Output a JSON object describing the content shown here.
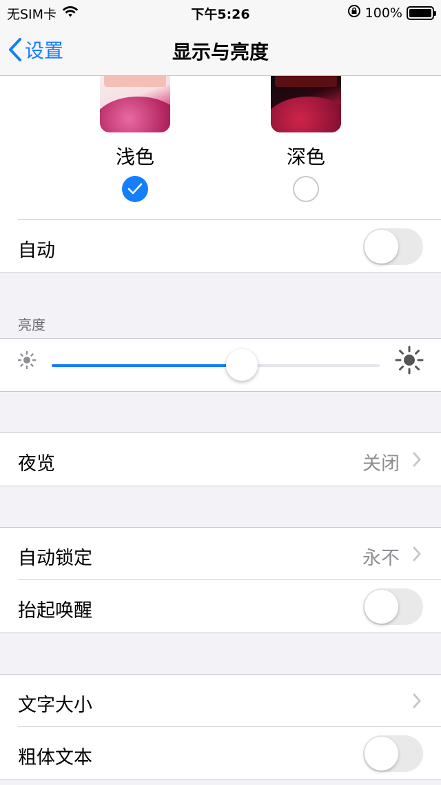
{
  "status_bar": {
    "carrier": "无SIM卡",
    "time": "下午5:26",
    "battery": "100%"
  },
  "nav": {
    "back_label": "设置",
    "title": "显示与亮度"
  },
  "appearance": {
    "light_label": "浅色",
    "dark_label": "深色",
    "selected": "light"
  },
  "auto_row": {
    "label": "自动",
    "on": false
  },
  "brightness": {
    "header": "亮度",
    "level": 0.58
  },
  "night_shift": {
    "label": "夜览",
    "value": "关闭"
  },
  "auto_lock": {
    "label": "自动锁定",
    "value": "永不"
  },
  "raise_to_wake": {
    "label": "抬起唤醒",
    "on": false
  },
  "text_size": {
    "label": "文字大小"
  },
  "bold_text": {
    "label": "粗体文本",
    "on": false
  },
  "colors": {
    "accent": "#157efb",
    "toggle_off": "#e9e9ea",
    "secondary_text": "#8e8e93"
  }
}
